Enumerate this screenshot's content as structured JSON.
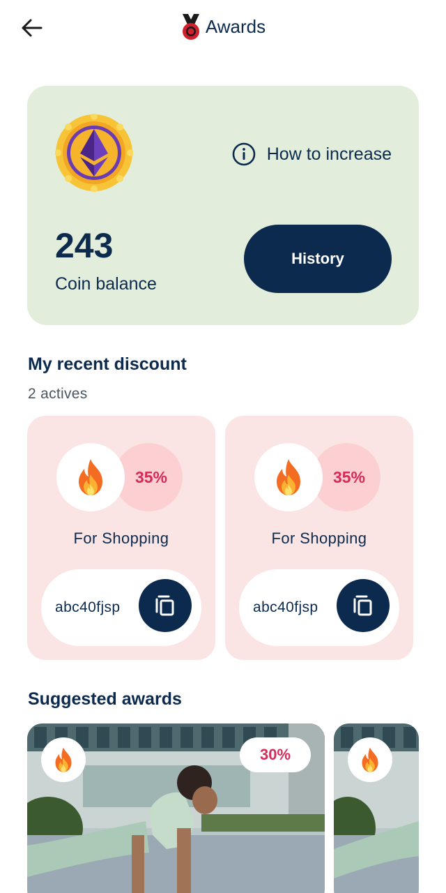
{
  "header": {
    "title": "Awards",
    "back_icon": "arrow-left-icon",
    "title_icon": "medal-icon"
  },
  "balance": {
    "value": "243",
    "label": "Coin balance",
    "how_to_increase": "How to increase",
    "history_button": "History",
    "coin_icon": "ethereum-coin-icon",
    "card_color": "#e2eedb"
  },
  "recent_discount": {
    "title": "My recent discount",
    "subtitle": "2 actives",
    "cards": [
      {
        "percent": "35%",
        "label": "For Shopping",
        "code": "abc40fjsp"
      },
      {
        "percent": "35%",
        "label": "For Shopping",
        "code": "abc40fjsp"
      }
    ]
  },
  "suggested": {
    "title": "Suggested awards",
    "cards": [
      {
        "percent": "30%"
      },
      {
        "percent": ""
      }
    ]
  },
  "colors": {
    "navy": "#0b2a4d",
    "pink_text": "#d62a5a",
    "discount_bg": "#fbe4e4"
  }
}
